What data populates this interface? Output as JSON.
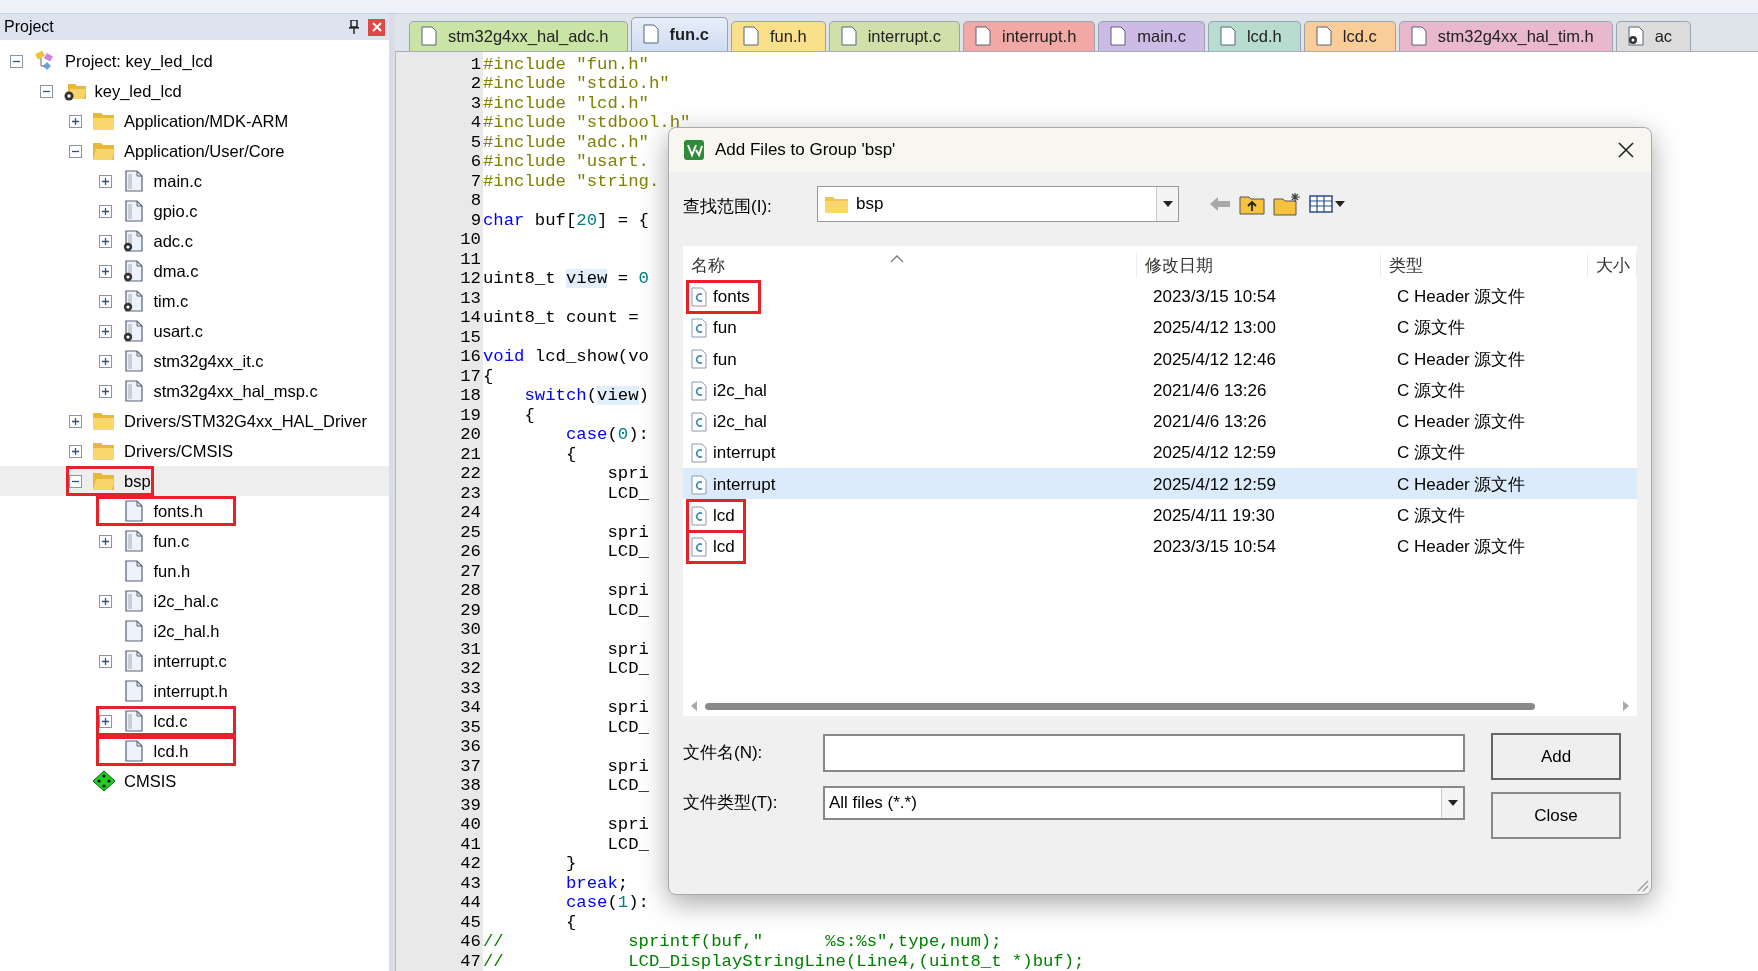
{
  "project_panel": {
    "title": "Project",
    "tree": [
      {
        "label": "Project: key_led_lcd",
        "kind": "project",
        "expanded": true,
        "selected": false,
        "marked": false,
        "children": [
          {
            "label": "key_led_lcd",
            "kind": "target",
            "expanded": true,
            "selected": false,
            "marked": false,
            "children": [
              {
                "label": "Application/MDK-ARM",
                "kind": "group",
                "expanded": false,
                "selected": false,
                "marked": false
              },
              {
                "label": "Application/User/Core",
                "kind": "group",
                "expanded": true,
                "selected": false,
                "marked": false,
                "children": [
                  {
                    "label": "main.c",
                    "kind": "file",
                    "expanded": false,
                    "custom_options": false,
                    "selected": false,
                    "marked": false
                  },
                  {
                    "label": "gpio.c",
                    "kind": "file",
                    "expanded": false,
                    "custom_options": false,
                    "selected": false,
                    "marked": false
                  },
                  {
                    "label": "adc.c",
                    "kind": "file",
                    "expanded": false,
                    "custom_options": true,
                    "selected": false,
                    "marked": false
                  },
                  {
                    "label": "dma.c",
                    "kind": "file",
                    "expanded": false,
                    "custom_options": true,
                    "selected": false,
                    "marked": false
                  },
                  {
                    "label": "tim.c",
                    "kind": "file",
                    "expanded": false,
                    "custom_options": true,
                    "selected": false,
                    "marked": false
                  },
                  {
                    "label": "usart.c",
                    "kind": "file",
                    "expanded": false,
                    "custom_options": true,
                    "selected": false,
                    "marked": false
                  },
                  {
                    "label": "stm32g4xx_it.c",
                    "kind": "file",
                    "expanded": false,
                    "custom_options": false,
                    "selected": false,
                    "marked": false
                  },
                  {
                    "label": "stm32g4xx_hal_msp.c",
                    "kind": "file",
                    "expanded": false,
                    "custom_options": false,
                    "selected": false,
                    "marked": false
                  }
                ]
              },
              {
                "label": "Drivers/STM32G4xx_HAL_Driver",
                "kind": "group",
                "expanded": false,
                "selected": false,
                "marked": false
              },
              {
                "label": "Drivers/CMSIS",
                "kind": "group",
                "expanded": false,
                "selected": false,
                "marked": false
              },
              {
                "label": "bsp",
                "kind": "group",
                "expanded": true,
                "selected": true,
                "marked": true,
                "children": [
                  {
                    "label": "fonts.h",
                    "kind": "file",
                    "custom_options": false,
                    "selected": false,
                    "marked": true
                  },
                  {
                    "label": "fun.c",
                    "kind": "file",
                    "expanded": false,
                    "custom_options": false,
                    "selected": false,
                    "marked": false
                  },
                  {
                    "label": "fun.h",
                    "kind": "file",
                    "custom_options": false,
                    "selected": false,
                    "marked": false
                  },
                  {
                    "label": "i2c_hal.c",
                    "kind": "file",
                    "expanded": false,
                    "custom_options": false,
                    "selected": false,
                    "marked": false
                  },
                  {
                    "label": "i2c_hal.h",
                    "kind": "file",
                    "custom_options": false,
                    "selected": false,
                    "marked": false
                  },
                  {
                    "label": "interrupt.c",
                    "kind": "file",
                    "expanded": false,
                    "custom_options": false,
                    "selected": false,
                    "marked": false
                  },
                  {
                    "label": "interrupt.h",
                    "kind": "file",
                    "custom_options": false,
                    "selected": false,
                    "marked": false
                  },
                  {
                    "label": "lcd.c",
                    "kind": "file",
                    "expanded": false,
                    "custom_options": false,
                    "selected": false,
                    "marked": true
                  },
                  {
                    "label": "lcd.h",
                    "kind": "file",
                    "custom_options": false,
                    "selected": false,
                    "marked": true
                  }
                ]
              },
              {
                "label": "CMSIS",
                "kind": "component",
                "selected": false,
                "marked": false
              }
            ]
          }
        ]
      }
    ]
  },
  "tabs": [
    {
      "label": "stm32g4xx_hal_adc.h",
      "color": "#c9e4a4",
      "selected": false,
      "kind": "file"
    },
    {
      "label": "fun.c",
      "color": "#cfdcf3",
      "selected": true,
      "kind": "file"
    },
    {
      "label": "fun.h",
      "color": "#fbe08c",
      "selected": false,
      "kind": "file"
    },
    {
      "label": "interrupt.c",
      "color": "#cfe0a8",
      "selected": false,
      "kind": "file"
    },
    {
      "label": "interrupt.h",
      "color": "#f2a8a4",
      "selected": false,
      "kind": "file"
    },
    {
      "label": "main.c",
      "color": "#cdbbe6",
      "selected": false,
      "kind": "file"
    },
    {
      "label": "lcd.h",
      "color": "#b8dcd0",
      "selected": false,
      "kind": "file"
    },
    {
      "label": "lcd.c",
      "color": "#f9cc98",
      "selected": false,
      "kind": "file"
    },
    {
      "label": "stm32g4xx_hal_tim.h",
      "color": "#eab8cc",
      "selected": false,
      "kind": "file"
    },
    {
      "label": "ac",
      "color": "#dcdcdc",
      "selected": false,
      "kind": "options-file"
    }
  ],
  "editor": {
    "lines": [
      {
        "n": "1",
        "code": [
          {
            "kind": "pp",
            "text": "#include \"fun.h\""
          }
        ]
      },
      {
        "n": "2",
        "code": [
          {
            "kind": "pp",
            "text": "#include \"stdio.h\""
          }
        ]
      },
      {
        "n": "3",
        "code": [
          {
            "kind": "pp",
            "text": "#include \"lcd.h\""
          }
        ]
      },
      {
        "n": "4",
        "code": [
          {
            "kind": "pp",
            "text": "#include \"stdbool.h\""
          }
        ]
      },
      {
        "n": "5",
        "code": [
          {
            "kind": "pp",
            "text": "#include \"adc.h\""
          }
        ]
      },
      {
        "n": "6",
        "code": [
          {
            "kind": "pp",
            "text": "#include \"usart."
          }
        ]
      },
      {
        "n": "7",
        "code": [
          {
            "kind": "pp",
            "text": "#include \"string."
          }
        ]
      },
      {
        "n": "8"
      },
      {
        "n": "9",
        "code": [
          {
            "kind": "kw",
            "text": "char"
          },
          {
            "kind": "tx",
            "text": " buf["
          },
          {
            "kind": "num",
            "text": "20"
          },
          {
            "kind": "tx",
            "text": "] = {"
          }
        ]
      },
      {
        "n": "10"
      },
      {
        "n": "11"
      },
      {
        "n": "12",
        "code": [
          {
            "kind": "tx",
            "text": "uint8_t "
          },
          {
            "kind": "hl",
            "text": "view"
          },
          {
            "kind": "tx",
            "text": " = "
          },
          {
            "kind": "num",
            "text": "0"
          }
        ]
      },
      {
        "n": "13"
      },
      {
        "n": "14",
        "code": [
          {
            "kind": "tx",
            "text": "uint8_t count = "
          }
        ]
      },
      {
        "n": "15"
      },
      {
        "n": "16",
        "code": [
          {
            "kind": "kw",
            "text": "void"
          },
          {
            "kind": "tx",
            "text": " lcd_show(vo"
          }
        ]
      },
      {
        "n": "17",
        "code": [
          {
            "kind": "tx",
            "text": "{"
          }
        ]
      },
      {
        "n": "18",
        "code": [
          {
            "kind": "kw",
            "text": "    switch"
          },
          {
            "kind": "tx",
            "text": "("
          },
          {
            "kind": "hl",
            "text": "view"
          },
          {
            "kind": "tx",
            "text": ")"
          }
        ]
      },
      {
        "n": "19",
        "code": [
          {
            "kind": "tx",
            "text": "    {"
          }
        ]
      },
      {
        "n": "20",
        "code": [
          {
            "kind": "kw",
            "text": "        case"
          },
          {
            "kind": "tx",
            "text": "("
          },
          {
            "kind": "num",
            "text": "0"
          },
          {
            "kind": "tx",
            "text": "):"
          }
        ]
      },
      {
        "n": "21",
        "code": [
          {
            "kind": "tx",
            "text": "        {"
          }
        ]
      },
      {
        "n": "22",
        "code": [
          {
            "kind": "tx",
            "text": "            spri"
          }
        ]
      },
      {
        "n": "23",
        "code": [
          {
            "kind": "tx",
            "text": "            LCD_"
          }
        ]
      },
      {
        "n": "24"
      },
      {
        "n": "25",
        "code": [
          {
            "kind": "tx",
            "text": "            spri"
          }
        ]
      },
      {
        "n": "26",
        "code": [
          {
            "kind": "tx",
            "text": "            LCD_"
          }
        ]
      },
      {
        "n": "27"
      },
      {
        "n": "28",
        "code": [
          {
            "kind": "tx",
            "text": "            spri"
          }
        ]
      },
      {
        "n": "29",
        "code": [
          {
            "kind": "tx",
            "text": "            LCD_"
          }
        ]
      },
      {
        "n": "30"
      },
      {
        "n": "31",
        "code": [
          {
            "kind": "tx",
            "text": "            spri"
          }
        ]
      },
      {
        "n": "32",
        "code": [
          {
            "kind": "tx",
            "text": "            LCD_"
          }
        ]
      },
      {
        "n": "33"
      },
      {
        "n": "34",
        "code": [
          {
            "kind": "tx",
            "text": "            spri"
          }
        ]
      },
      {
        "n": "35",
        "code": [
          {
            "kind": "tx",
            "text": "            LCD_"
          }
        ]
      },
      {
        "n": "36"
      },
      {
        "n": "37",
        "code": [
          {
            "kind": "tx",
            "text": "            spri"
          }
        ]
      },
      {
        "n": "38",
        "code": [
          {
            "kind": "tx",
            "text": "            LCD_"
          }
        ]
      },
      {
        "n": "39"
      },
      {
        "n": "40",
        "code": [
          {
            "kind": "tx",
            "text": "            spri"
          }
        ]
      },
      {
        "n": "41",
        "code": [
          {
            "kind": "tx",
            "text": "            LCD_"
          }
        ]
      },
      {
        "n": "42",
        "code": [
          {
            "kind": "tx",
            "text": "        }"
          }
        ]
      },
      {
        "n": "43",
        "code": [
          {
            "kind": "kw",
            "text": "        break"
          },
          {
            "kind": "tx",
            "text": ";"
          }
        ]
      },
      {
        "n": "44",
        "code": [
          {
            "kind": "kw",
            "text": "        case"
          },
          {
            "kind": "tx",
            "text": "("
          },
          {
            "kind": "num",
            "text": "1"
          },
          {
            "kind": "tx",
            "text": "):"
          }
        ]
      },
      {
        "n": "45",
        "code": [
          {
            "kind": "tx",
            "text": "        {"
          }
        ]
      },
      {
        "n": "46",
        "code": [
          {
            "kind": "cm",
            "text": "//            sprintf(buf,\"      %s:%s\",type,num);"
          }
        ]
      },
      {
        "n": "47",
        "code": [
          {
            "kind": "cm",
            "text": "//            LCD_DisplayStringLine(Line4,(uint8_t *)buf);"
          }
        ]
      }
    ]
  },
  "dialog": {
    "title": "Add Files to Group 'bsp'",
    "look_in": {
      "label": "查找范围(I):",
      "value": "bsp"
    },
    "columns": [
      "名称",
      "修改日期",
      "类型",
      "大小"
    ],
    "files": [
      {
        "name": "fonts",
        "modified": "2023/3/15 10:54",
        "type": "C Header 源文件",
        "selected": false,
        "marked": true
      },
      {
        "name": "fun",
        "modified": "2025/4/12 13:00",
        "type": "C 源文件",
        "selected": false,
        "marked": false
      },
      {
        "name": "fun",
        "modified": "2025/4/12 12:46",
        "type": "C Header 源文件",
        "selected": false,
        "marked": false
      },
      {
        "name": "i2c_hal",
        "modified": "2021/4/6 13:26",
        "type": "C 源文件",
        "selected": false,
        "marked": false
      },
      {
        "name": "i2c_hal",
        "modified": "2021/4/6 13:26",
        "type": "C Header 源文件",
        "selected": false,
        "marked": false
      },
      {
        "name": "interrupt",
        "modified": "2025/4/12 12:59",
        "type": "C 源文件",
        "selected": false,
        "marked": false
      },
      {
        "name": "interrupt",
        "modified": "2025/4/12 12:59",
        "type": "C Header 源文件",
        "selected": true,
        "marked": false
      },
      {
        "name": "lcd",
        "modified": "2025/4/11 19:30",
        "type": "C 源文件",
        "selected": false,
        "marked": true
      },
      {
        "name": "lcd",
        "modified": "2023/3/15 10:54",
        "type": "C Header 源文件",
        "selected": false,
        "marked": true
      }
    ],
    "file_name": {
      "label": "文件名(N):"
    },
    "file_type": {
      "label": "文件类型(T):",
      "value": "All files (*.*)"
    },
    "buttons": [
      "Add",
      "Close"
    ]
  }
}
